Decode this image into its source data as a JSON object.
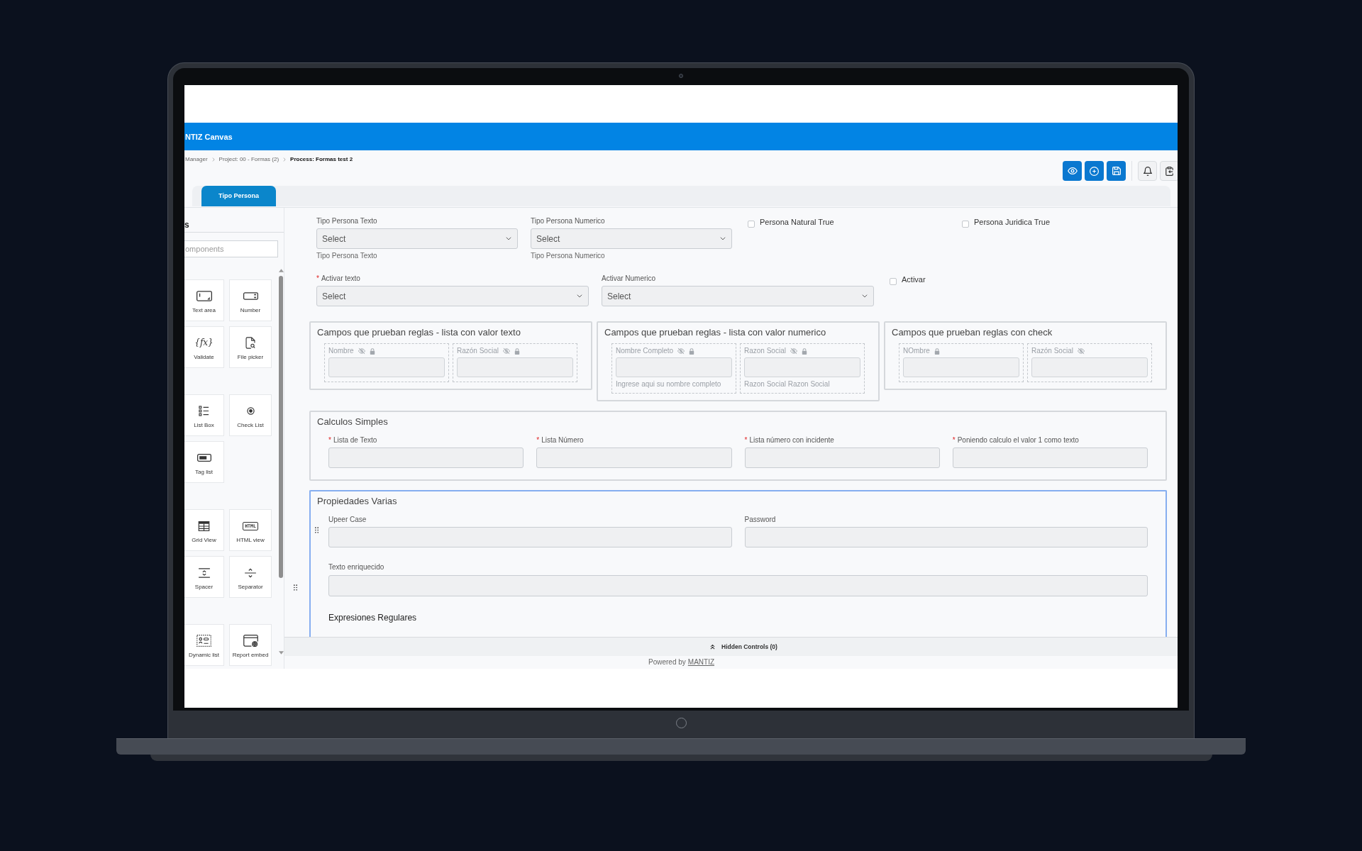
{
  "header": {
    "title": "NTIZ Canvas"
  },
  "breadcrumb": [
    {
      "label": "Manager",
      "current": false
    },
    {
      "label": "Project: 00 - Formas (2)",
      "current": false
    },
    {
      "label": "Process: Formas test 2",
      "current": true
    }
  ],
  "toolbar": [
    {
      "kind": "primary"
    },
    {
      "kind": "primary"
    },
    {
      "kind": "primary"
    },
    {
      "kind": "divider"
    },
    {
      "kind": "secondary"
    },
    {
      "kind": "secondary"
    }
  ],
  "tabs": [
    {
      "label": "Tipo Persona",
      "selected": true
    }
  ],
  "components_panel": {
    "title": "s",
    "search": {
      "placeholder": "omponents"
    },
    "groups": [
      {
        "items": [
          {
            "label": "Text area"
          },
          {
            "label": "Validate",
            "icon_text": "{fx}"
          },
          {
            "label": "Number"
          },
          {
            "label": "File picker"
          }
        ]
      },
      {
        "items": [
          {
            "label": "List Box"
          },
          {
            "label": "Tag list"
          },
          {
            "label": "Check List"
          }
        ]
      },
      {
        "items": [
          {
            "label": "Grid View"
          },
          {
            "label": "Spacer"
          },
          {
            "label": "HTML view",
            "icon_text": "HTML"
          },
          {
            "label": "Separator"
          }
        ]
      },
      {
        "items": [
          {
            "label": "Dynamic list"
          },
          {
            "label": "Report embed"
          }
        ]
      }
    ]
  },
  "form": {
    "rows": [
      {
        "fields": [
          {
            "kind": "select",
            "label": "Tipo Persona Texto",
            "placeholder": "Select",
            "hint": "Tipo Persona Texto"
          },
          {
            "kind": "select",
            "label": "Tipo Persona Numerico",
            "placeholder": "Select",
            "hint": "Tipo Persona Numerico"
          },
          {
            "kind": "checkbox",
            "label": "Persona Natural True",
            "checked": false
          },
          {
            "kind": "checkbox",
            "label": "Persona Juridica True",
            "checked": false
          }
        ]
      },
      {
        "fields": [
          {
            "kind": "select",
            "label": "Activar texto",
            "required_mark": "*",
            "placeholder": "Select"
          },
          {
            "kind": "select",
            "label": "Activar Numerico",
            "placeholder": "Select"
          },
          {
            "kind": "checkbox",
            "label": "Activar",
            "checked": false
          }
        ]
      }
    ],
    "rule_groups": [
      {
        "title": "Campos que prueban reglas - lista con valor texto",
        "fields": [
          {
            "label": "Nombre",
            "hidden": true,
            "read_only": true
          },
          {
            "label": "Razón Social",
            "hidden": true,
            "read_only": true
          }
        ]
      },
      {
        "title": "Campos que prueban reglas - lista con valor numerico",
        "fields": [
          {
            "label": "Nombre Completo",
            "hidden": true,
            "read_only": true,
            "hint": "Ingrese aqui su nombre completo"
          },
          {
            "label": "Razon Social",
            "hidden": true,
            "read_only": true,
            "hint": "Razon Social Razon Social"
          }
        ]
      },
      {
        "title": "Campos que prueban reglas con check",
        "fields": [
          {
            "label": "NOmbre",
            "hidden": false,
            "read_only": true
          },
          {
            "label": "Razón Social",
            "hidden": true,
            "read_only": false
          }
        ]
      }
    ],
    "sections": [
      {
        "title": "Calculos Simples",
        "selected": false,
        "fields": [
          {
            "kind": "text",
            "label": "Lista de Texto",
            "required_mark": "*"
          },
          {
            "kind": "text",
            "label": "Lista Número",
            "required_mark": "*"
          },
          {
            "kind": "text",
            "label": "Lista número con incidente",
            "required_mark": "*"
          },
          {
            "kind": "text",
            "label": "Poniendo calculo el valor 1 como texto",
            "required_mark": "*"
          }
        ]
      },
      {
        "title": "Propiedades Varias",
        "selected": true,
        "fields": [
          {
            "kind": "text",
            "label": "Upeer Case"
          },
          {
            "kind": "text",
            "label": "Password"
          },
          {
            "kind": "rich_text",
            "label": "Texto enriquecido"
          },
          {
            "kind": "heading",
            "label": "Expresiones Regulares"
          }
        ]
      }
    ]
  },
  "hidden_controls": {
    "label": "Hidden Controls (0)"
  },
  "footer": {
    "text": "Powered by",
    "link": "MANTIZ"
  }
}
